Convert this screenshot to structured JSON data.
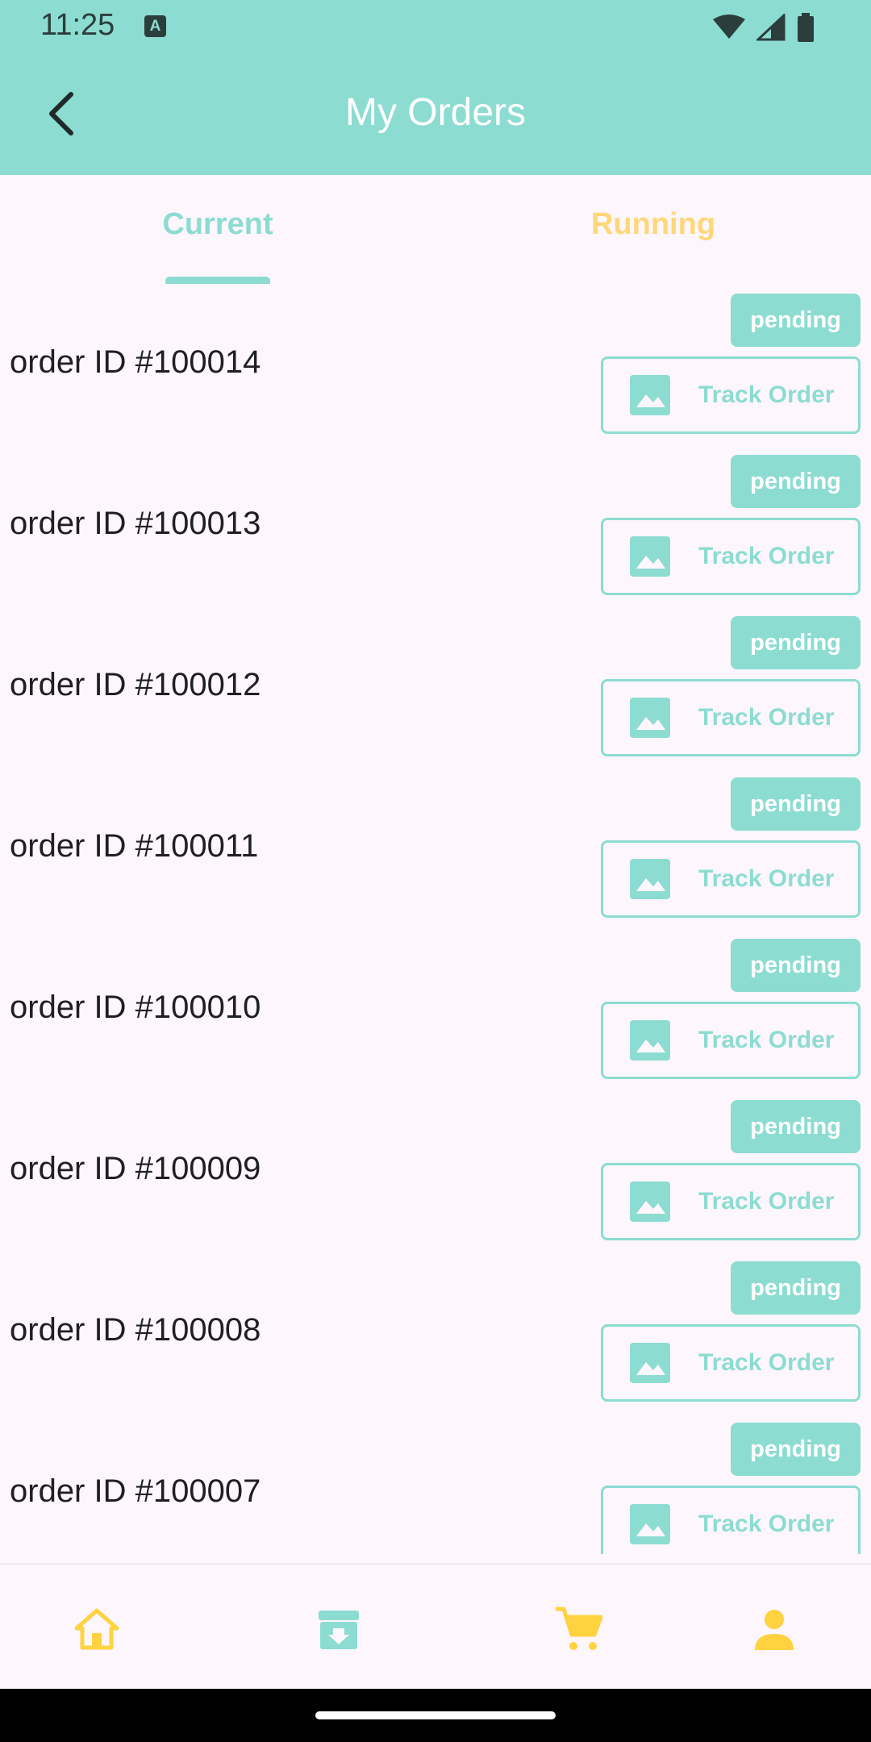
{
  "status_bar": {
    "time": "11:25",
    "notification_icon": "a-icon",
    "icons": [
      "wifi-icon",
      "signal-icon",
      "battery-icon"
    ]
  },
  "app_bar": {
    "title": "My Orders",
    "back_icon": "back-arrow-icon"
  },
  "tabs": [
    {
      "label": "Current",
      "selected": true
    },
    {
      "label": "Running",
      "selected": false
    }
  ],
  "orders": [
    {
      "id_label": "order ID #100014",
      "status": "pending",
      "action_label": "Track Order"
    },
    {
      "id_label": "order ID #100013",
      "status": "pending",
      "action_label": "Track Order"
    },
    {
      "id_label": "order ID #100012",
      "status": "pending",
      "action_label": "Track Order"
    },
    {
      "id_label": "order ID #100011",
      "status": "pending",
      "action_label": "Track Order"
    },
    {
      "id_label": "order ID #100010",
      "status": "pending",
      "action_label": "Track Order"
    },
    {
      "id_label": "order ID #100009",
      "status": "pending",
      "action_label": "Track Order"
    },
    {
      "id_label": "order ID #100008",
      "status": "pending",
      "action_label": "Track Order"
    },
    {
      "id_label": "order ID #100007",
      "status": "pending",
      "action_label": "Track Order"
    }
  ],
  "bottom_nav": [
    "home-icon",
    "archive-download-icon",
    "cart-icon",
    "person-icon"
  ],
  "colors": {
    "primary": "#8cdcd2",
    "accent": "#ffd77a",
    "background": "#fdf6fc"
  }
}
